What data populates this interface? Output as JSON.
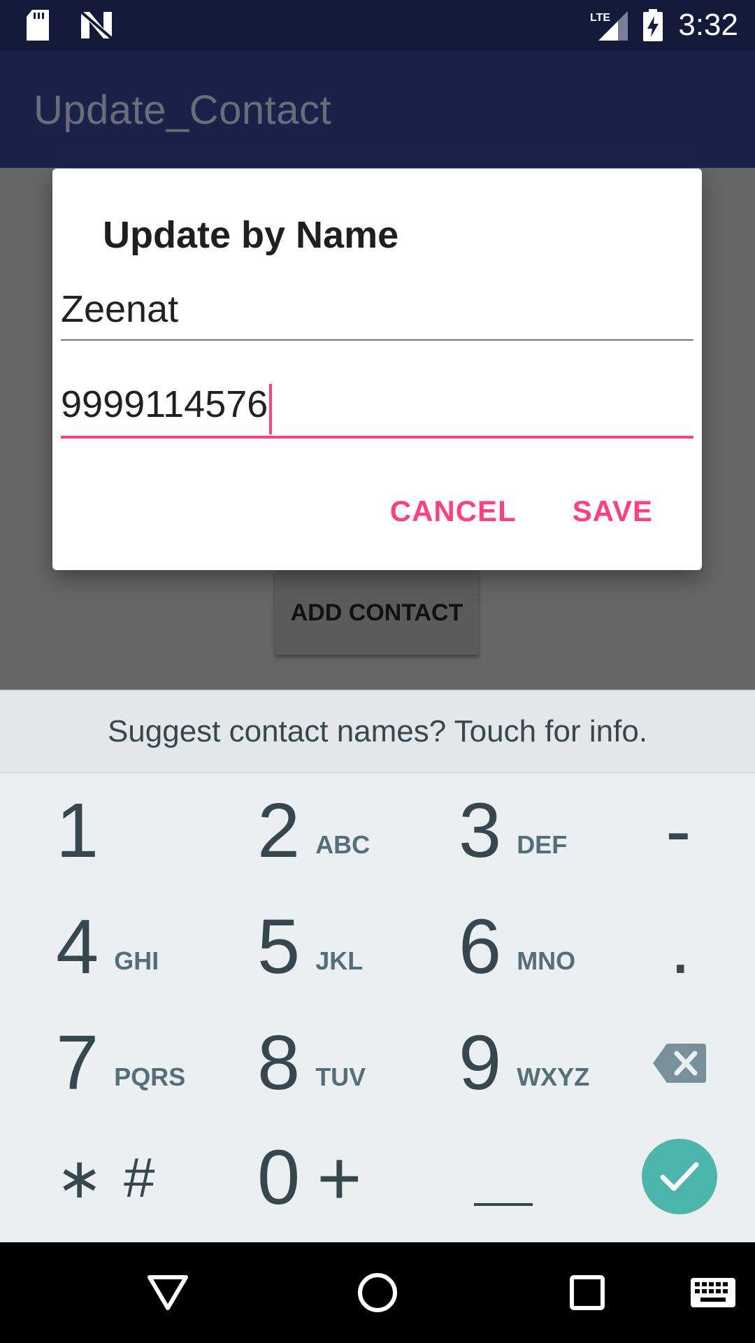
{
  "status_bar": {
    "time": "3:32",
    "network": "LTE",
    "icons": [
      "sd-card-icon",
      "n-logo-icon",
      "signal-icon",
      "battery-charging-icon"
    ]
  },
  "app_bar": {
    "title": "Update_Contact"
  },
  "main": {
    "add_contact_label": "ADD CONTACT"
  },
  "dialog": {
    "title": "Update by Name",
    "name_value": "Zeenat",
    "phone_value": "9999114576",
    "cancel_label": "CANCEL",
    "save_label": "SAVE",
    "accent_color": "#ff4081"
  },
  "keyboard": {
    "suggestion": "Suggest contact names? Touch for info.",
    "keys": {
      "k1": {
        "digit": "1",
        "letters": ""
      },
      "k2": {
        "digit": "2",
        "letters": "ABC"
      },
      "k3": {
        "digit": "3",
        "letters": "DEF"
      },
      "k4": {
        "digit": "4",
        "letters": "GHI"
      },
      "k5": {
        "digit": "5",
        "letters": "JKL"
      },
      "k6": {
        "digit": "6",
        "letters": "MNO"
      },
      "k7": {
        "digit": "7",
        "letters": "PQRS"
      },
      "k8": {
        "digit": "8",
        "letters": "TUV"
      },
      "k9": {
        "digit": "9",
        "letters": "WXYZ"
      },
      "k0": {
        "digit": "0",
        "letters": ""
      }
    },
    "dash": "-",
    "dot": ".",
    "star": "∗",
    "hash": "#",
    "plus": "+",
    "done_color": "#4db6ac"
  },
  "nav_bar": {
    "icons": [
      "back-icon",
      "home-icon",
      "recents-icon",
      "keyboard-icon"
    ]
  }
}
